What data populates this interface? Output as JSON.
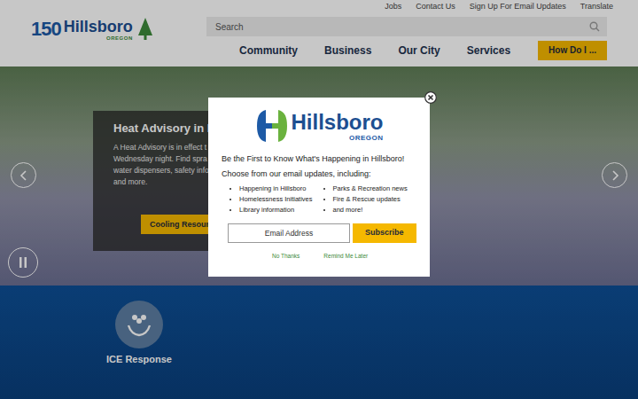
{
  "utility_links": [
    "Jobs",
    "Contact Us",
    "Sign Up For Email Updates",
    "Translate"
  ],
  "logo": {
    "anniversary": "150",
    "name": "Hillsboro",
    "region": "OREGON"
  },
  "search": {
    "placeholder": "Search"
  },
  "nav": {
    "items": [
      "Community",
      "Business",
      "Our City",
      "Services"
    ],
    "action": "How Do I ..."
  },
  "hero": {
    "title": "Heat Advisory in Ef",
    "lines": [
      "A Heat Advisory is in effect t",
      "Wednesday night. Find spra",
      "water dispensers, safety info",
      "and more."
    ],
    "button": "Cooling Resour",
    "playing": true
  },
  "quick_links": [
    {
      "label": "ICE Response"
    }
  ],
  "modal": {
    "logo": {
      "name": "Hillsboro",
      "region": "OREGON"
    },
    "heading": "Be the First to Know What's Happening in Hillsboro!",
    "intro": "Choose from our email updates, including:",
    "topics": [
      "Happening in Hillsboro",
      "Homelessness Initiatives",
      "Library information",
      "Parks & Recreation news",
      "Fire & Rescue updates",
      "and more!"
    ],
    "email_placeholder": "Email Address",
    "subscribe": "Subscribe",
    "no_thanks": "No Thanks",
    "remind": "Remind Me Later"
  }
}
